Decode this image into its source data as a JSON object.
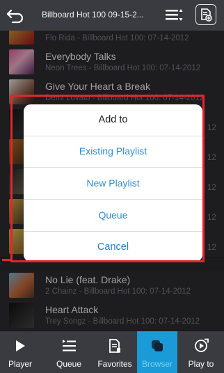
{
  "header": {
    "title": "Billboard Hot 100 09-15-2..."
  },
  "list": {
    "rows": [
      {
        "title": "",
        "sub": "Flo Rida - Billboard Hot 100: 07-14-2012"
      },
      {
        "title": "Everybody Talks",
        "sub": "Neon Trees - Billboard Hot 100: 07-14-2012"
      },
      {
        "title": "Give Your Heart a Break",
        "sub": "Demi Lovato - Billboard Hot 100: 07-14-2012"
      },
      {
        "title": "",
        "sub": "12"
      },
      {
        "title": "",
        "sub": "12"
      },
      {
        "title": "",
        "sub": "12"
      },
      {
        "title": "",
        "sub": "12"
      },
      {
        "title": "",
        "sub": "12"
      },
      {
        "title": "No Lie (feat. Drake)",
        "sub": "2 Chainz - Billboard Hot 100: 07-14-2012"
      },
      {
        "title": "Heart Attack",
        "sub": "Trey Songz - Billboard Hot 100: 07-14-2012"
      }
    ]
  },
  "dialog": {
    "title": "Add to",
    "options": [
      "Existing Playlist",
      "New Playlist",
      "Queue"
    ],
    "cancel": "Cancel"
  },
  "tabs": [
    {
      "label": "Player",
      "icon": "play-icon"
    },
    {
      "label": "Queue",
      "icon": "queue-icon"
    },
    {
      "label": "Favorites",
      "icon": "favorites-icon"
    },
    {
      "label": "Browser",
      "icon": "browser-icon",
      "active": true
    },
    {
      "label": "Play to",
      "icon": "play-to-icon"
    }
  ],
  "colors": {
    "accent": "#1a9ad6",
    "highlight": "#e1262c",
    "link": "#2f8dd6"
  }
}
